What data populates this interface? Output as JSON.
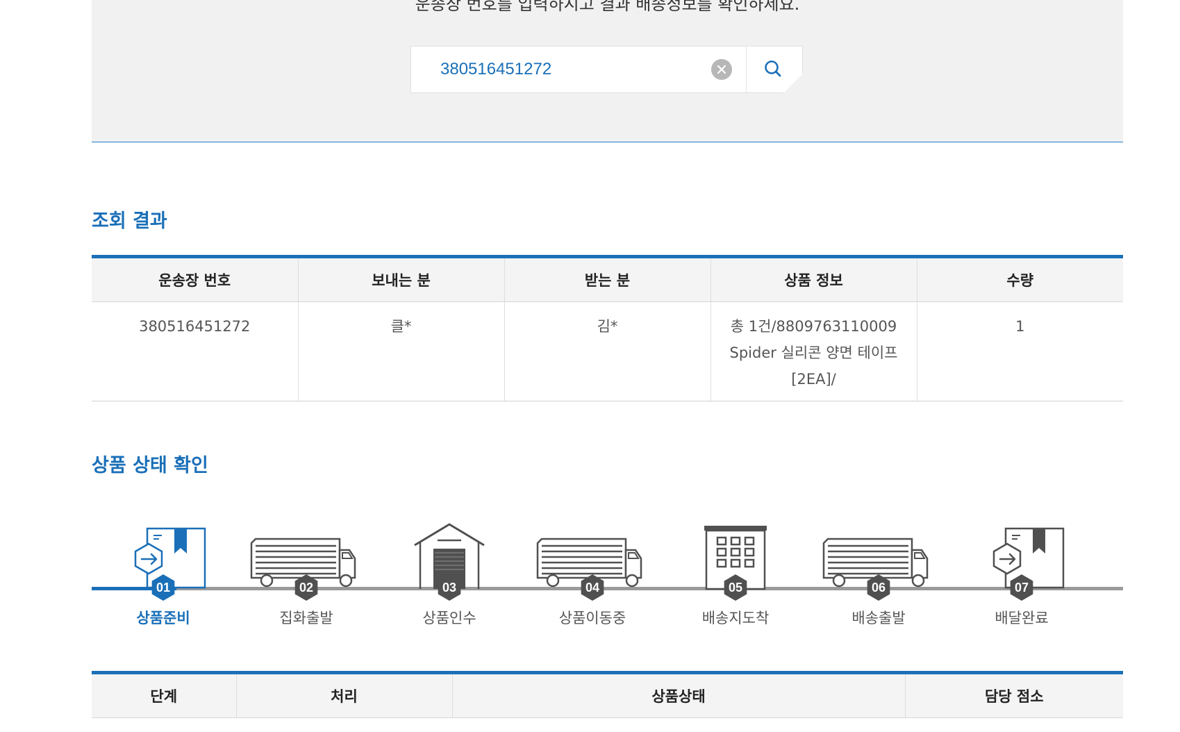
{
  "search": {
    "instruction": "운송장 번호를 입력하시고 결과 배송정보를 확인하세요.",
    "value": "380516451272"
  },
  "result": {
    "title": "조회 결과",
    "headers": [
      "운송장 번호",
      "보내는 분",
      "받는 분",
      "상품 정보",
      "수량"
    ],
    "row": {
      "tracking_number": "380516451272",
      "sender": "클*",
      "receiver": "김*",
      "product_info": "총 1건/8809763110009\nSpider 실리콘 양면 테이프\n[2EA]/",
      "quantity": "1"
    }
  },
  "status": {
    "title": "상품 상태 확인",
    "active_step": 1,
    "steps": [
      {
        "number": "01",
        "label": "상품준비",
        "icon": "box-icon"
      },
      {
        "number": "02",
        "label": "집화출발",
        "icon": "truck-icon"
      },
      {
        "number": "03",
        "label": "상품인수",
        "icon": "warehouse-icon"
      },
      {
        "number": "04",
        "label": "상품이동중",
        "icon": "truck-icon"
      },
      {
        "number": "05",
        "label": "배송지도착",
        "icon": "building-icon"
      },
      {
        "number": "06",
        "label": "배송출발",
        "icon": "truck-icon"
      },
      {
        "number": "07",
        "label": "배달완료",
        "icon": "box-icon"
      }
    ]
  },
  "detail": {
    "headers": [
      "단계",
      "처리",
      "상품상태",
      "담당 점소"
    ]
  },
  "colors": {
    "accent": "#1a6fb8",
    "inactive_step": "#505050",
    "panel_bg": "#f1f1f1"
  }
}
